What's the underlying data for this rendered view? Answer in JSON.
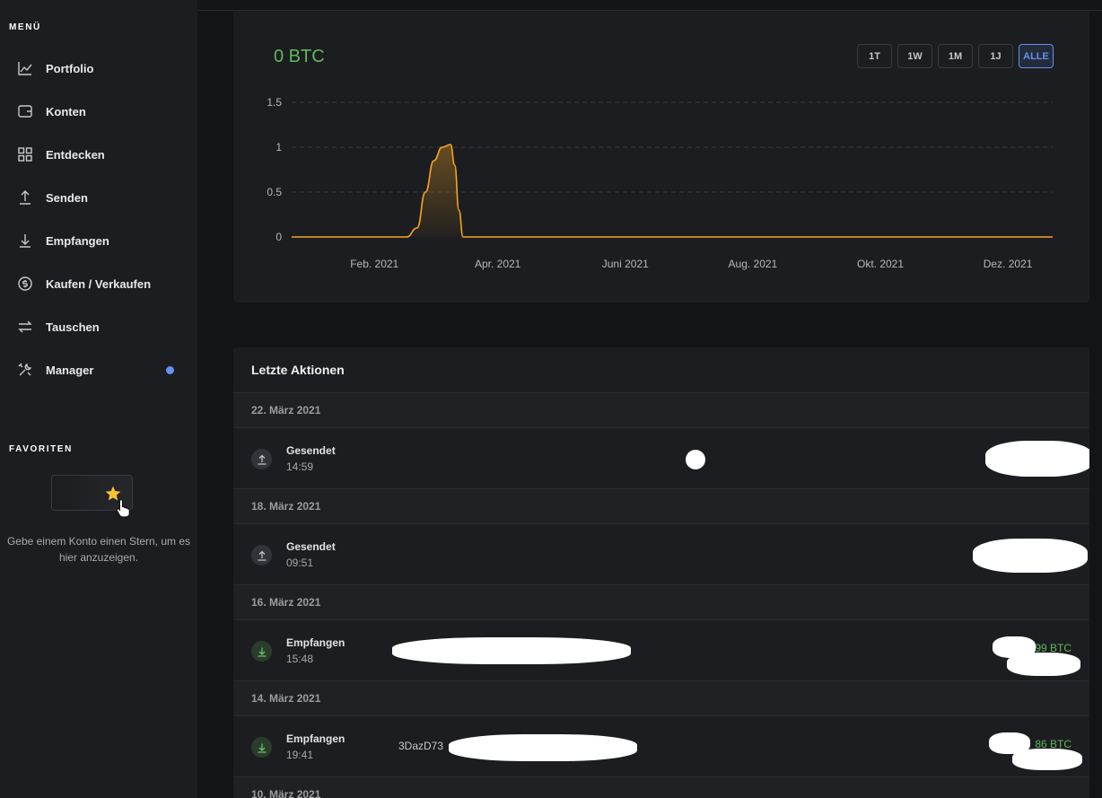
{
  "sidebar": {
    "menu_title": "MENÜ",
    "items": [
      {
        "label": "Portfolio",
        "icon": "chart-line-icon"
      },
      {
        "label": "Konten",
        "icon": "wallet-icon"
      },
      {
        "label": "Entdecken",
        "icon": "grid-icon"
      },
      {
        "label": "Senden",
        "icon": "arrow-up-icon"
      },
      {
        "label": "Empfangen",
        "icon": "arrow-down-icon"
      },
      {
        "label": "Kaufen / Verkaufen",
        "icon": "dollar-circle-icon"
      },
      {
        "label": "Tauschen",
        "icon": "swap-icon"
      },
      {
        "label": "Manager",
        "icon": "tools-icon",
        "badge_color": "#6490f1"
      }
    ],
    "favorites_title": "FAVORITEN",
    "favorites_hint": "Gebe einem Konto einen Stern, um es hier anzuzeigen."
  },
  "chart_card": {
    "balance": "0 BTC",
    "ranges": [
      {
        "label": "1T",
        "active": false
      },
      {
        "label": "1W",
        "active": false
      },
      {
        "label": "1M",
        "active": false
      },
      {
        "label": "1J",
        "active": false
      },
      {
        "label": "ALLE",
        "active": true
      }
    ]
  },
  "chart_data": {
    "type": "area",
    "title": "",
    "xlabel": "",
    "ylabel": "",
    "ylim": [
      0,
      1.5
    ],
    "y_ticks": [
      "0",
      "0.5",
      "1",
      "1.5"
    ],
    "x_tick_labels": [
      "Feb. 2021",
      "Apr. 2021",
      "Juni 2021",
      "Aug. 2021",
      "Okt. 2021",
      "Dez. 2021"
    ],
    "grid": true,
    "series": [
      {
        "color": "#f5a623",
        "points": [
          {
            "x": "2021-01-01",
            "y": 0
          },
          {
            "x": "2021-02-25",
            "y": 0
          },
          {
            "x": "2021-03-02",
            "y": 0.1
          },
          {
            "x": "2021-03-06",
            "y": 0.5
          },
          {
            "x": "2021-03-10",
            "y": 0.85
          },
          {
            "x": "2021-03-14",
            "y": 1.0
          },
          {
            "x": "2021-03-18",
            "y": 1.03
          },
          {
            "x": "2021-03-20",
            "y": 0.8
          },
          {
            "x": "2021-03-22",
            "y": 0.3
          },
          {
            "x": "2021-03-24",
            "y": 0
          },
          {
            "x": "2021-12-31",
            "y": 0
          }
        ]
      }
    ]
  },
  "actions": {
    "title": "Letzte Aktionen",
    "groups": [
      {
        "date": "22. März 2021",
        "type": "Gesendet",
        "time": "14:59",
        "kind": "send",
        "address": "",
        "amount": ""
      },
      {
        "date": "18. März 2021",
        "type": "Gesendet",
        "time": "09:51",
        "kind": "send",
        "address": "",
        "amount": ""
      },
      {
        "date": "16. März 2021",
        "type": "Empfangen",
        "time": "15:48",
        "kind": "recv",
        "address": "",
        "amount": "99 BTC"
      },
      {
        "date": "14. März 2021",
        "type": "Empfangen",
        "time": "19:41",
        "kind": "recv",
        "address": "3DazD73",
        "amount": "86 BTC"
      },
      {
        "date": "10. März 2021"
      }
    ]
  },
  "colors": {
    "accent": "#6490f1",
    "positive": "#5fb95b",
    "chart_line": "#f5a623"
  }
}
